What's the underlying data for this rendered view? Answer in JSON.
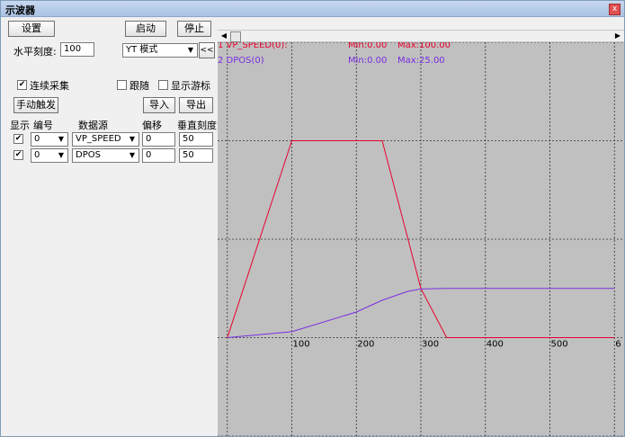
{
  "window": {
    "title": "示波器",
    "close_label": "x"
  },
  "controls": {
    "settings_label": "设置",
    "start_label": "启动",
    "stop_label": "停止",
    "h_scale_label": "水平刻度:",
    "h_scale_value": "100",
    "mode_value": "YT 模式",
    "collapse_label": "<<",
    "continuous_label": "连续采集",
    "continuous_checked": true,
    "follow_label": "跟随",
    "follow_checked": false,
    "cursor_label": "显示游标",
    "cursor_checked": false,
    "manual_trigger_label": "手动触发",
    "import_label": "导入",
    "export_label": "导出"
  },
  "channel_table": {
    "headers": [
      "显示",
      "编号",
      "数据源",
      "偏移",
      "垂直刻度"
    ],
    "rows": [
      {
        "show": true,
        "number": "0",
        "source": "VP_SPEED",
        "offset": "0",
        "v_scale": "50"
      },
      {
        "show": true,
        "number": "0",
        "source": "DPOS",
        "offset": "0",
        "v_scale": "50"
      }
    ]
  },
  "plot": {
    "background": "#c0c0c0",
    "series_labels": [
      {
        "label": "1 VP_SPEED(0):",
        "min": "Min:0.00",
        "max": "Max:100.00",
        "color": "#e8002c"
      },
      {
        "label": "2 DPOS(0)",
        "min": "Min:0.00",
        "max": "Max:25.00",
        "color": "#7a2ee0"
      }
    ],
    "x_tick_labels": [
      "100",
      "200",
      "300",
      "400",
      "500",
      "6"
    ]
  },
  "chart_data": {
    "type": "line",
    "x": [
      0,
      100,
      200,
      240,
      280,
      300,
      340,
      400,
      500,
      600
    ],
    "series": [
      {
        "name": "1 VP_SPEED(0):",
        "values": [
          0,
          100,
          100,
          100,
          50,
          25,
          0,
          0,
          0,
          0
        ],
        "color": "#e8002c"
      },
      {
        "name": "2 DPOS(0)",
        "values": [
          0,
          3,
          13,
          19,
          23.5,
          24.7,
          25,
          25,
          25,
          25
        ],
        "color": "#7a2ee0"
      }
    ],
    "xlim": [
      -15,
      615
    ],
    "ylim": [
      -50,
      150
    ],
    "grid": true
  }
}
